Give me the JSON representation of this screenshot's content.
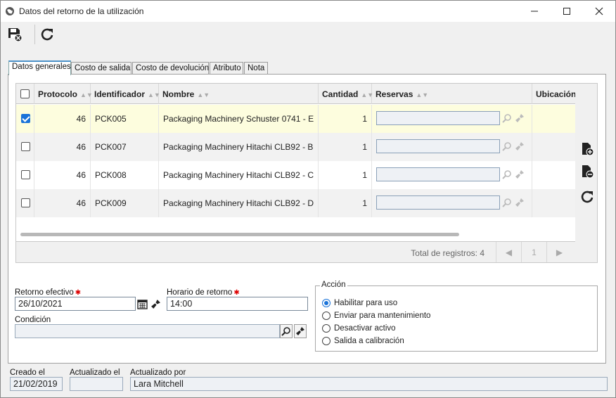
{
  "window": {
    "title": "Datos del retorno de la utilización"
  },
  "toolbar": {
    "save": "save-icon",
    "refresh": "refresh-icon"
  },
  "tabs": [
    {
      "label": "Datos generales"
    },
    {
      "label": "Costo de salida"
    },
    {
      "label": "Costo de devolución"
    },
    {
      "label": "Atributo"
    },
    {
      "label": "Nota"
    }
  ],
  "grid": {
    "columns": [
      "Protocolo",
      "Identificador",
      "Nombre",
      "Cantidad",
      "Reservas",
      "Ubicación"
    ],
    "rows": [
      {
        "checked": true,
        "protocolo": "46",
        "identificador": "PCK005",
        "nombre": "Packaging Machinery Schuster 0741 - E",
        "cantidad": "1"
      },
      {
        "checked": false,
        "protocolo": "46",
        "identificador": "PCK007",
        "nombre": "Packaging Machinery Hitachi CLB92 - B",
        "cantidad": "1"
      },
      {
        "checked": false,
        "protocolo": "46",
        "identificador": "PCK008",
        "nombre": "Packaging Machinery Hitachi CLB92 - C",
        "cantidad": "1"
      },
      {
        "checked": false,
        "protocolo": "46",
        "identificador": "PCK009",
        "nombre": "Packaging Machinery Hitachi CLB92 - D",
        "cantidad": "1"
      }
    ],
    "total": "Total de registros: 4",
    "page": "1"
  },
  "form": {
    "retorno_label": "Retorno efectivo",
    "retorno_value": "26/10/2021",
    "horario_label": "Horario de retorno",
    "horario_value": "14:00",
    "condicion_label": "Condición",
    "condicion_value": "",
    "accion_title": "Acción",
    "acciones": [
      {
        "label": "Habilitar para uso",
        "selected": true
      },
      {
        "label": "Enviar para mantenimiento",
        "selected": false
      },
      {
        "label": "Desactivar activo",
        "selected": false
      },
      {
        "label": "Salida a calibración",
        "selected": false
      }
    ]
  },
  "footer": {
    "creado_label": "Creado el",
    "creado_value": "21/02/2019",
    "actualizado_label": "Actualizado el",
    "actualizado_value": "",
    "actualizado_por_label": "Actualizado por",
    "actualizado_por_value": "Lara Mitchell"
  },
  "colors": {
    "accent": "#1a73d9",
    "selected_row": "#fdfdde",
    "required": "#dd0000"
  }
}
